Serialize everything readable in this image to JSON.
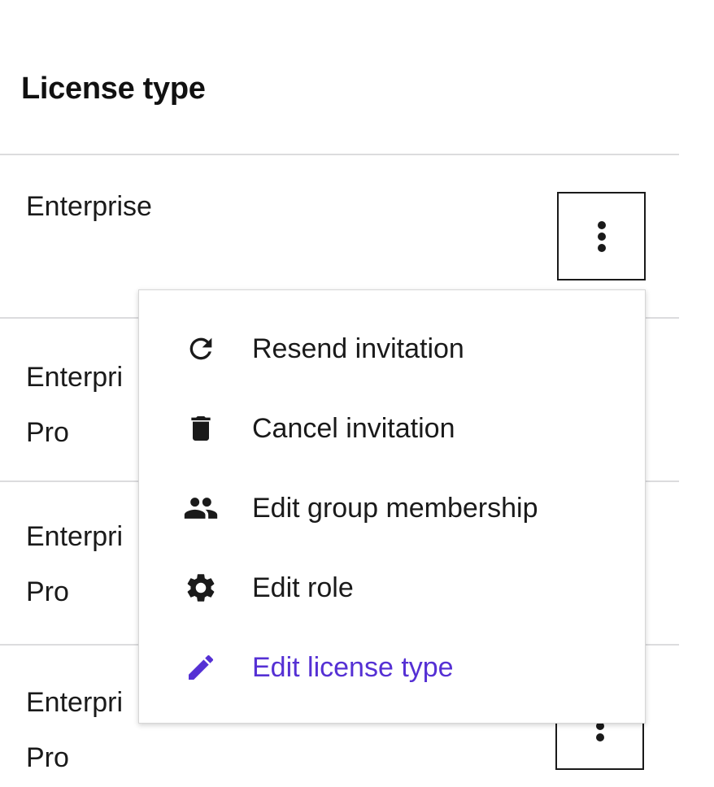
{
  "table": {
    "column_header": "License type",
    "rows": [
      {
        "line1": "Enterprise",
        "line2": ""
      },
      {
        "line1": "Enterpri",
        "line2": "Pro"
      },
      {
        "line1": "Enterpri",
        "line2": "Pro"
      },
      {
        "line1": "Enterpri",
        "line2": "Pro"
      }
    ]
  },
  "menu": {
    "items": [
      {
        "label": "Resend invitation",
        "icon": "refresh-icon"
      },
      {
        "label": "Cancel invitation",
        "icon": "trash-icon"
      },
      {
        "label": "Edit group membership",
        "icon": "people-icon"
      },
      {
        "label": "Edit role",
        "icon": "gear-icon"
      },
      {
        "label": "Edit license type",
        "icon": "pencil-icon"
      }
    ]
  },
  "colors": {
    "accent": "#5530d4",
    "text": "#1a1a1a",
    "divider": "#dcdcde"
  }
}
